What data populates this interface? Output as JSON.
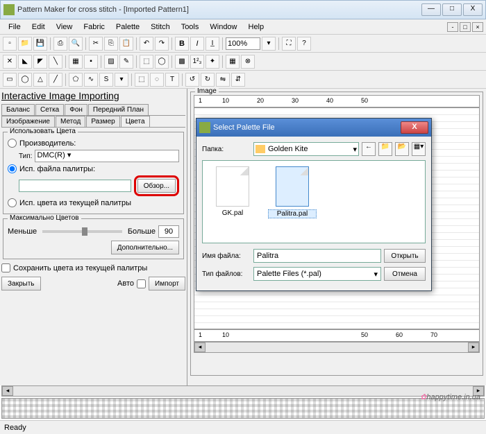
{
  "window": {
    "title": "Pattern Maker for cross stitch - [Imported Pattern1]"
  },
  "menu": {
    "items": [
      "File",
      "Edit",
      "View",
      "Fabric",
      "Palette",
      "Stitch",
      "Tools",
      "Window",
      "Help"
    ]
  },
  "toolbar": {
    "zoom": "100%"
  },
  "panel": {
    "title": "Interactive Image Importing",
    "tabs_row1": [
      "Баланс",
      "Сетка",
      "Фон",
      "Передний План"
    ],
    "tabs_row2": [
      "Изображение",
      "Метод",
      "Размер",
      "Цвета"
    ],
    "group_colors": {
      "title": "Использовать Цвета",
      "radio_manufacturer": "Производитель:",
      "type_label": "Тип:",
      "type_value": "DMC(R)",
      "radio_file": "Исп. файла палитры:",
      "browse_btn": "Обзор...",
      "radio_current": "Исп. цвета из текущей палитры"
    },
    "group_max": {
      "title": "Максимально Цветов",
      "less": "Меньше",
      "more": "Больше",
      "value": "90",
      "advanced_btn": "Дополнительно..."
    },
    "save_check": "Сохранить цвета из текущей палитры",
    "close_btn": "Закрыть",
    "auto_label": "Авто",
    "import_btn": "Импорт"
  },
  "image_panel": {
    "title": "Image",
    "ruler_ticks": [
      "1",
      "10",
      "20",
      "30",
      "40",
      "50",
      "60",
      "70"
    ]
  },
  "dialog": {
    "title": "Select Palette File",
    "folder_label": "Папка:",
    "folder_value": "Golden Kite",
    "files": [
      {
        "name": "GK.pal",
        "selected": false
      },
      {
        "name": "Palitra.pal",
        "selected": true
      }
    ],
    "filename_label": "Имя файла:",
    "filename_value": "Palitra",
    "filetype_label": "Тип файлов:",
    "filetype_value": "Palette Files (*.pal)",
    "open_btn": "Открыть",
    "cancel_btn": "Отмена"
  },
  "status": {
    "text": "Ready"
  },
  "watermark": "happytime.in.ua"
}
